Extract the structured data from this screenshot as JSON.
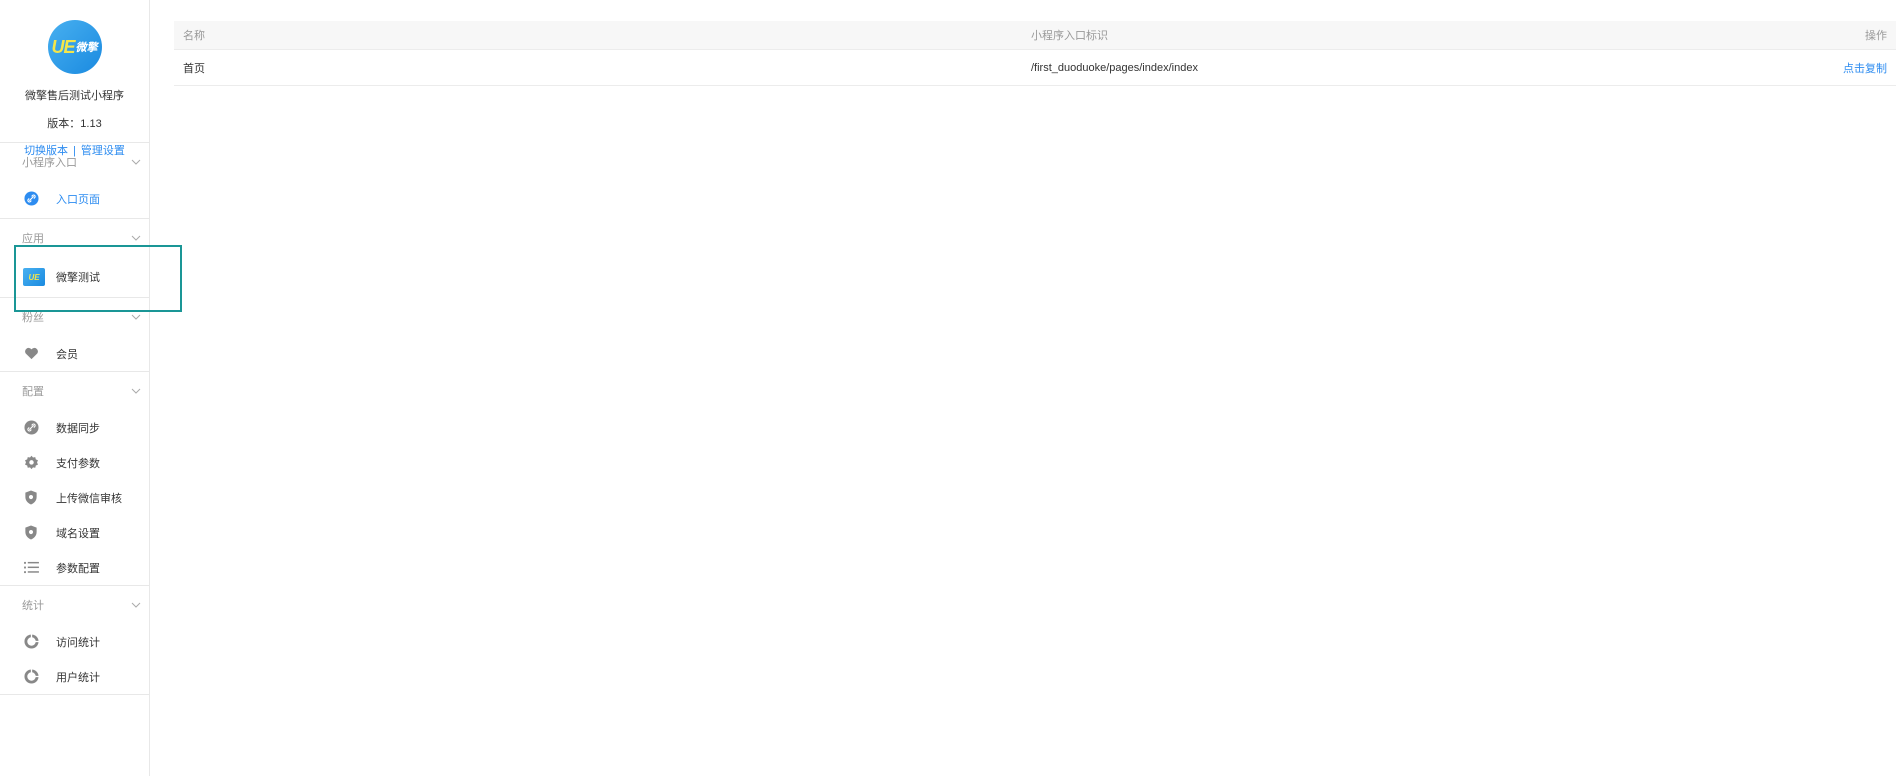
{
  "profile": {
    "logo_text": "UE",
    "logo_sub": "微擎",
    "app_name": "微擎售后测试小程序",
    "version": "版本：1.13",
    "switch_version": "切换版本",
    "separator": "|",
    "manage_settings": "管理设置"
  },
  "sidebar": {
    "groups": [
      {
        "title": "小程序入口",
        "items": [
          {
            "label": "入口页面",
            "icon": "link-icon",
            "active": true
          }
        ]
      },
      {
        "title": "应用",
        "items": [
          {
            "label": "微擎测试",
            "icon": "app-logo-icon"
          }
        ]
      },
      {
        "title": "粉丝",
        "items": [
          {
            "label": "会员",
            "icon": "heart-icon"
          }
        ]
      },
      {
        "title": "配置",
        "items": [
          {
            "label": "数据同步",
            "icon": "sync-icon"
          },
          {
            "label": "支付参数",
            "icon": "gear-icon"
          },
          {
            "label": "上传微信审核",
            "icon": "shield-icon"
          },
          {
            "label": "域名设置",
            "icon": "shield-icon"
          },
          {
            "label": "参数配置",
            "icon": "list-icon"
          }
        ]
      },
      {
        "title": "统计",
        "items": [
          {
            "label": "访问统计",
            "icon": "pie-chart-icon"
          },
          {
            "label": "用户统计",
            "icon": "pie-chart-icon"
          }
        ]
      }
    ]
  },
  "table": {
    "headers": {
      "name": "名称",
      "path": "小程序入口标识",
      "action": "操作"
    },
    "rows": [
      {
        "name": "首页",
        "path": "/first_duoduoke/pages/index/index",
        "action": "点击复制"
      }
    ]
  },
  "colors": {
    "accent": "#2d8cf0",
    "highlight": "#1a9696"
  }
}
